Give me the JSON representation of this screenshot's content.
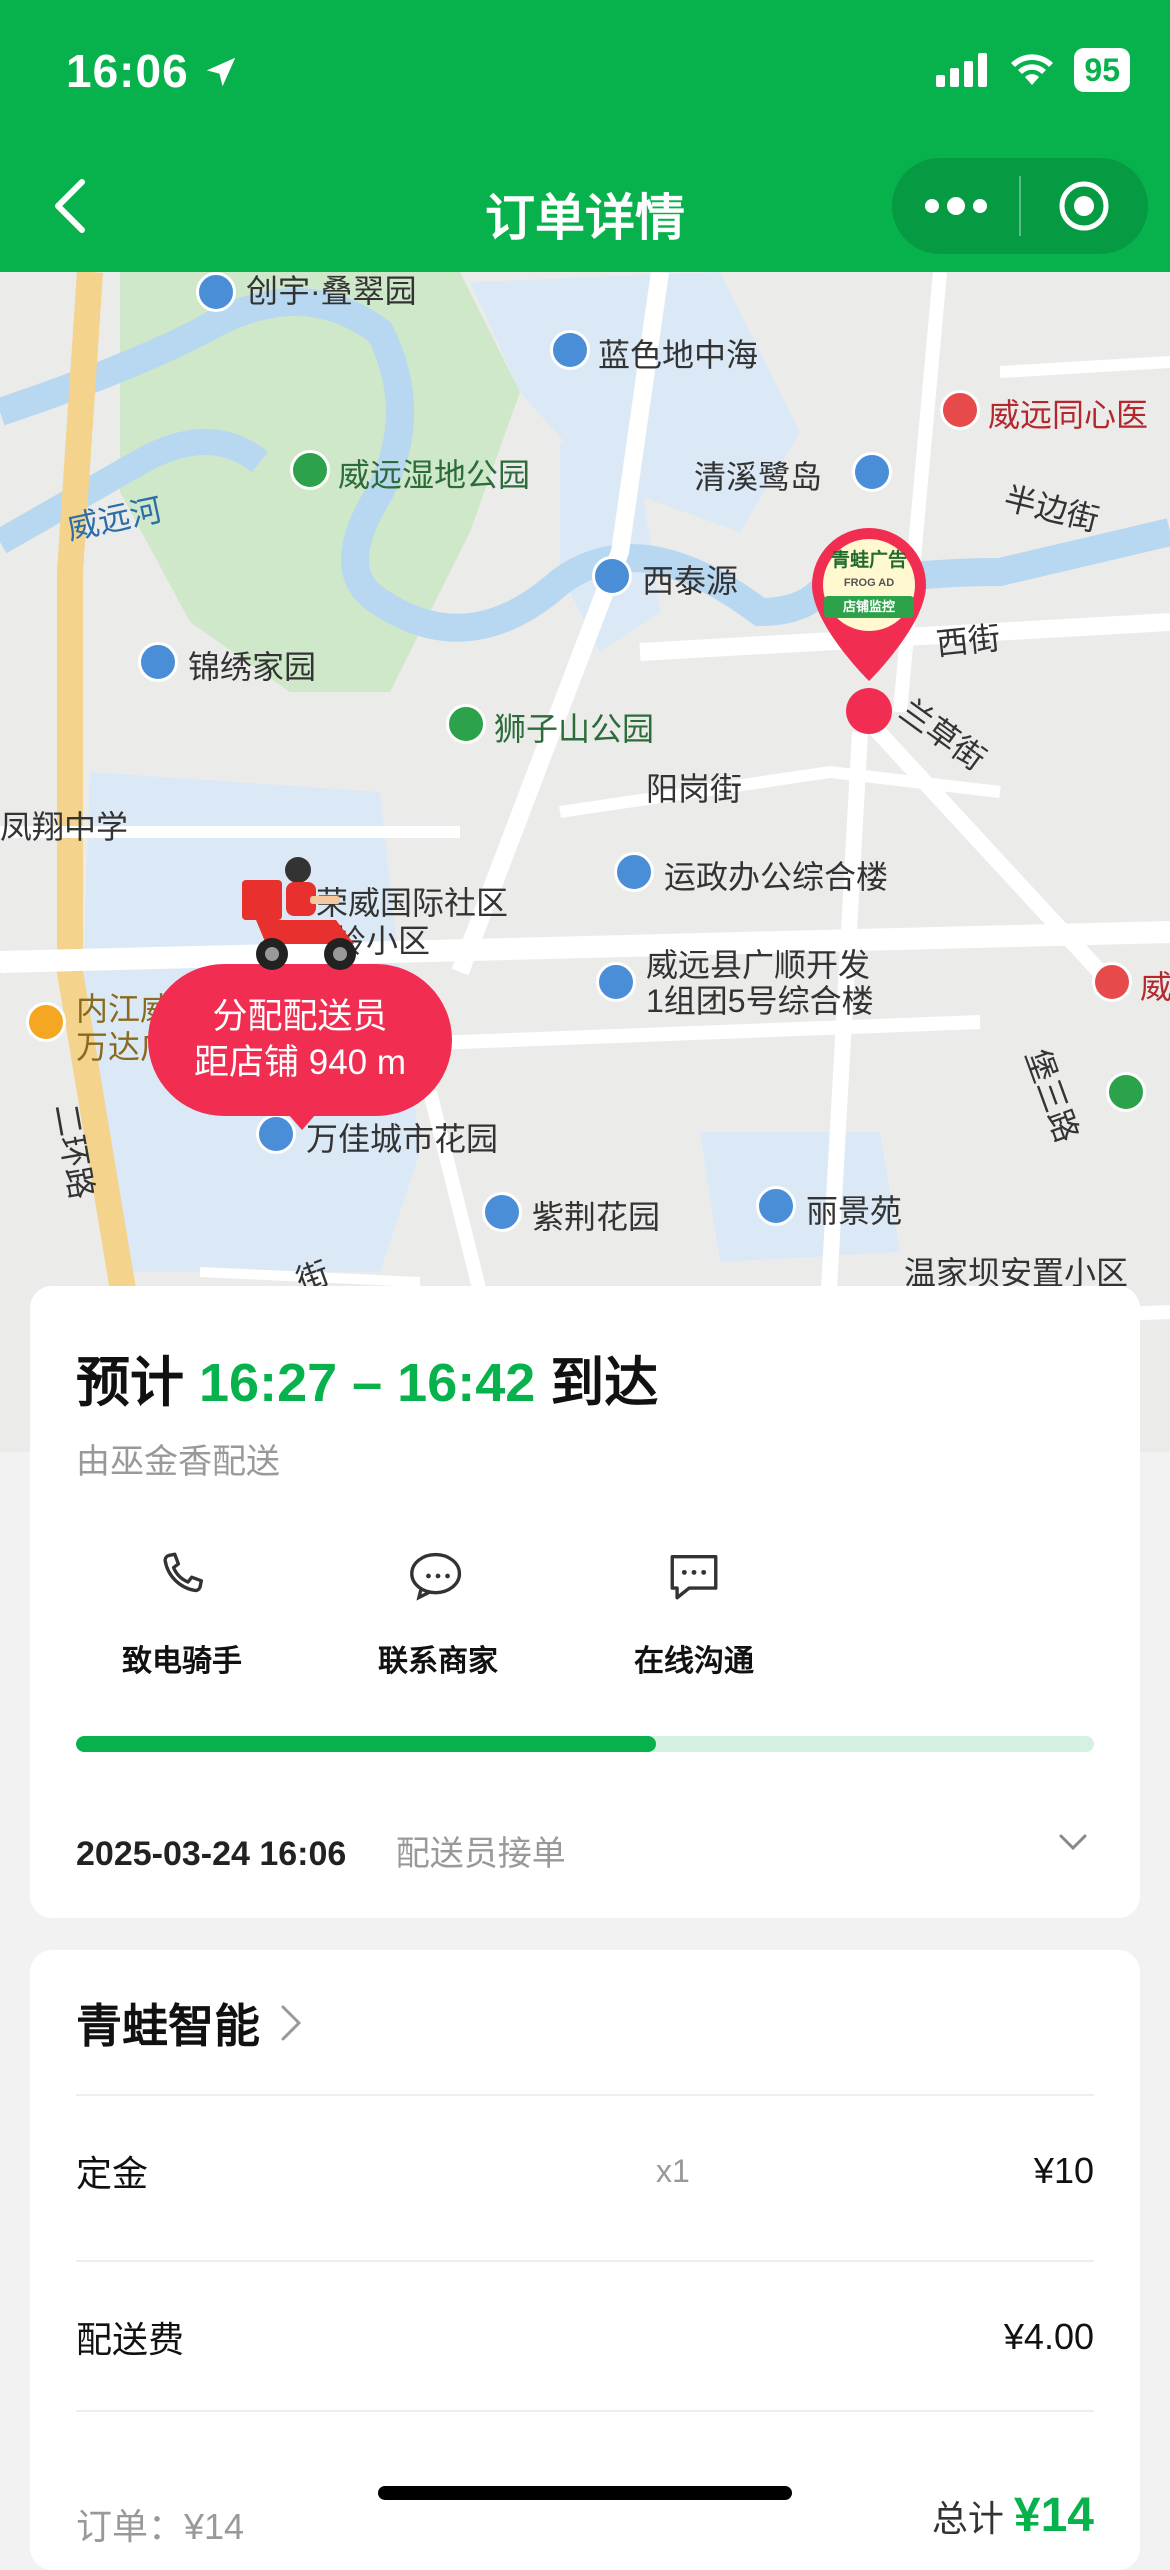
{
  "status": {
    "time": "16:06",
    "battery": "95"
  },
  "nav": {
    "title": "订单详情"
  },
  "map": {
    "labels": {
      "chuangyu": "创宇·叠翠园",
      "lanse": "蓝色地中海",
      "tongxin": "威远同心医",
      "shidi": "威远湿地公园",
      "qingxi": "清溪鹭岛",
      "banbian": "半边街",
      "weiyuanhe": "威远河",
      "xitai": "西泰源",
      "jinxiu": "锦绣家园",
      "shizishan": "狮子山公园",
      "xijie": "西街",
      "lancao": "兰草街",
      "yanggang": "阳岗街",
      "fengxiang": "凤翔中学",
      "yunzheng": "运政办公综合楼",
      "rongwei": "荣威国际社区",
      "hexiao": "岭小区",
      "guangshun1": "威远县广顺开发",
      "guangshun2": "1组团5号综合楼",
      "wei": "威",
      "wanda1": "内江威远",
      "wanda2": "万达广场",
      "huanlu": "二环路",
      "wanjia": "万佳城市花园",
      "baosan": "堡三路",
      "zijing": "紫荆花园",
      "lijing": "丽景苑",
      "wenjia": "温家坝安置小区",
      "bottom": "街"
    },
    "bubble": {
      "line1": "分配配送员",
      "line2": "距店铺 940 m"
    },
    "store_logo": {
      "name": "青蛙广告",
      "sub": "FROG AD",
      "tag": "店铺监控"
    }
  },
  "delivery": {
    "eta_prefix": "预计",
    "eta_range": "16:27 – 16:42",
    "eta_suffix": "到达",
    "rider_text": "由巫金香配送",
    "actions": [
      {
        "label": "致电骑手",
        "icon": "phone-icon"
      },
      {
        "label": "联系商家",
        "icon": "chat-bubble-icon"
      },
      {
        "label": "在线沟通",
        "icon": "message-icon"
      }
    ],
    "progress": 0.57,
    "track_time": "2025-03-24 16:06",
    "track_status": "配送员接单"
  },
  "order": {
    "shop_name": "青蛙智能",
    "items": [
      {
        "name": "定金",
        "qty": "x1",
        "price": "¥10"
      },
      {
        "name": "配送费",
        "qty": "",
        "price": "¥4.00"
      }
    ],
    "subtotal_label": "订单：¥14",
    "total_label": "总计",
    "total_value": "¥14"
  },
  "colors": {
    "brand": "#07b14c",
    "bubble": "#f12e52"
  }
}
